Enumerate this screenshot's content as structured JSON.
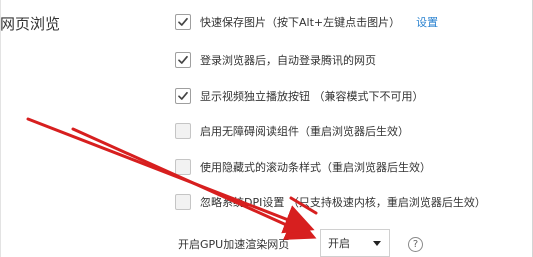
{
  "section": {
    "title": "网页浏览"
  },
  "options": [
    {
      "label": "快速保存图片（按下Alt+左键点击图片）",
      "checked": true,
      "link": "设置"
    },
    {
      "label": "登录浏览器后，自动登录腾讯的网页",
      "checked": true
    },
    {
      "label": "显示视频独立播放按钮 （兼容模式下不可用）",
      "checked": true
    },
    {
      "label": "启用无障碍阅读组件（重启浏览器后生效）",
      "checked": false
    },
    {
      "label": "使用隐藏式的滚动条样式（重启浏览器后生效）",
      "checked": false
    },
    {
      "label": "忽略系统DPI设置 （只支持极速内核，重启浏览器后生效）",
      "checked": false
    }
  ],
  "gpu": {
    "label": "开启GPU加速渲染网页",
    "selected": "开启",
    "help": "?"
  },
  "colors": {
    "link": "#2a82d0",
    "annotation": "#d71f1f",
    "checkbox_mark": "#444444"
  },
  "icons": {
    "checkmark": "checkmark-icon",
    "dropdown": "chevron-down-icon",
    "help": "help-icon"
  }
}
